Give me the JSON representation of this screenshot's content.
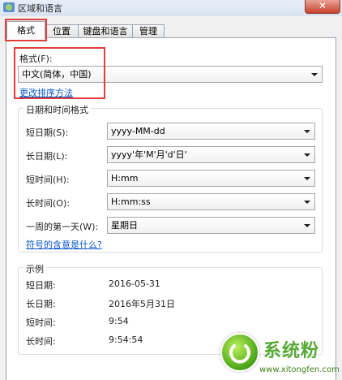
{
  "window": {
    "title": "区域和语言",
    "close_label": "✕"
  },
  "tabs": [
    "格式",
    "位置",
    "键盘和语言",
    "管理"
  ],
  "format": {
    "label": "格式(F):",
    "value": "中文(简体，中国)",
    "link": "更改排序方法"
  },
  "datetime_group": {
    "title": "日期和时间格式",
    "rows": [
      {
        "label": "短日期(S):",
        "value": "yyyy-MM-dd"
      },
      {
        "label": "长日期(L):",
        "value": "yyyy'年'M'月'd'日'"
      },
      {
        "label": "短时间(H):",
        "value": "H:mm"
      },
      {
        "label": "长时间(O):",
        "value": "H:mm:ss"
      },
      {
        "label": "一周的第一天(W):",
        "value": "星期日"
      }
    ],
    "link": "符号的含意是什么?"
  },
  "example_group": {
    "title": "示例",
    "rows": [
      {
        "label": "短日期:",
        "value": "2016-05-31"
      },
      {
        "label": "长日期:",
        "value": "2016年5月31日"
      },
      {
        "label": "短时间:",
        "value": "9:54"
      },
      {
        "label": "长时间:",
        "value": "9:54:54"
      }
    ]
  },
  "watermark": {
    "brand": "系统粉",
    "url": "www.xitongfen.com"
  },
  "colors": {
    "annotation": "#e03d3d",
    "link": "#0b57c6",
    "watermark": "#3b9b12"
  }
}
